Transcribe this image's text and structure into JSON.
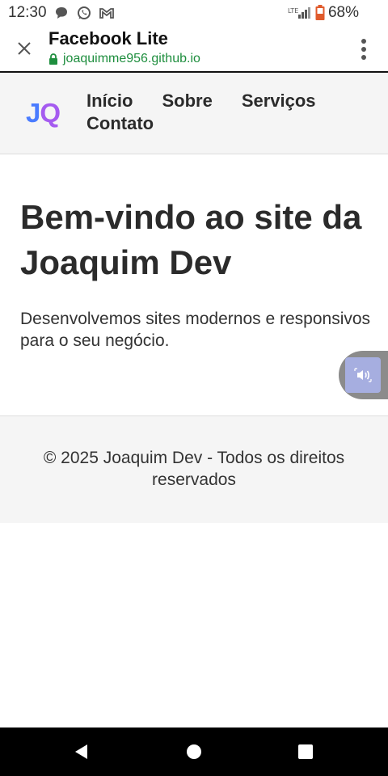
{
  "status_bar": {
    "time": "12:30",
    "battery": "68%",
    "icons": [
      "chat-bubble-icon",
      "whatsapp-icon",
      "gmail-icon",
      "lte-signal-icon",
      "battery-icon"
    ]
  },
  "browser": {
    "title": "Facebook Lite",
    "url": "joaquimme956.github.io",
    "url_color": "#1e8e3e"
  },
  "site": {
    "logo": {
      "j": "J",
      "q": "Q"
    },
    "nav": [
      "Início",
      "Sobre",
      "Serviços",
      "Contato"
    ]
  },
  "hero": {
    "title": "Bem-vindo ao site da Joaquim Dev",
    "text": "Desenvolvemos sites modernos e responsivos para o seu negócio."
  },
  "footer": {
    "text": "© 2025 Joaquim Dev - Todos os direitos reservados"
  },
  "colors": {
    "logo_j": "#4a7cff",
    "logo_q": "#a55bf0",
    "section_bg": "#f5f5f5",
    "fab_bg": "#8b8b8b",
    "fab_inner": "#a6aee0"
  }
}
